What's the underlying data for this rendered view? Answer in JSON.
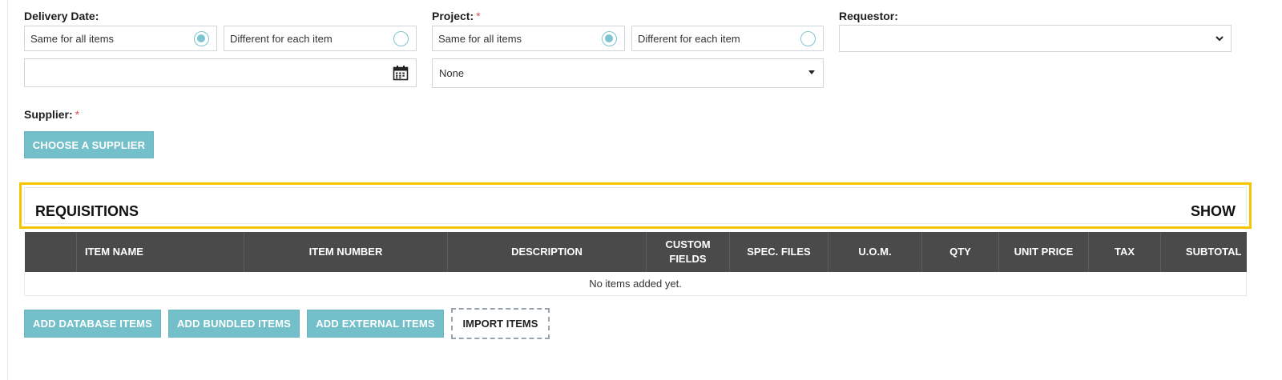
{
  "delivery": {
    "label": "Delivery Date:",
    "same_label": "Same for all items",
    "different_label": "Different for each item",
    "selected": "same",
    "date_value": "",
    "calendar_icon": "calendar-icon"
  },
  "project": {
    "label": "Project:",
    "required_mark": "*",
    "same_label": "Same for all items",
    "different_label": "Different for each item",
    "selected": "same",
    "select_value": "None"
  },
  "requestor": {
    "label": "Requestor:",
    "select_value": ""
  },
  "supplier": {
    "label": "Supplier:",
    "required_mark": "*",
    "choose_button": "CHOOSE A SUPPLIER"
  },
  "requisitions": {
    "title": "REQUISITIONS",
    "toggle": "SHOW",
    "highlight_color": "#f7c400"
  },
  "table": {
    "columns": [
      "",
      "ITEM NAME",
      "ITEM NUMBER",
      "DESCRIPTION",
      "CUSTOM FIELDS",
      "SPEC. FILES",
      "U.O.M.",
      "QTY",
      "UNIT PRICE",
      "TAX",
      "SUBTOTAL"
    ],
    "empty_message": "No items added yet."
  },
  "actions": {
    "add_database": "ADD DATABASE ITEMS",
    "add_bundled": "ADD BUNDLED ITEMS",
    "add_external": "ADD EXTERNAL ITEMS",
    "import": "IMPORT ITEMS"
  },
  "colors": {
    "accent": "#73bfca",
    "header_bg": "#4a4a4a",
    "required": "#d9534f"
  }
}
